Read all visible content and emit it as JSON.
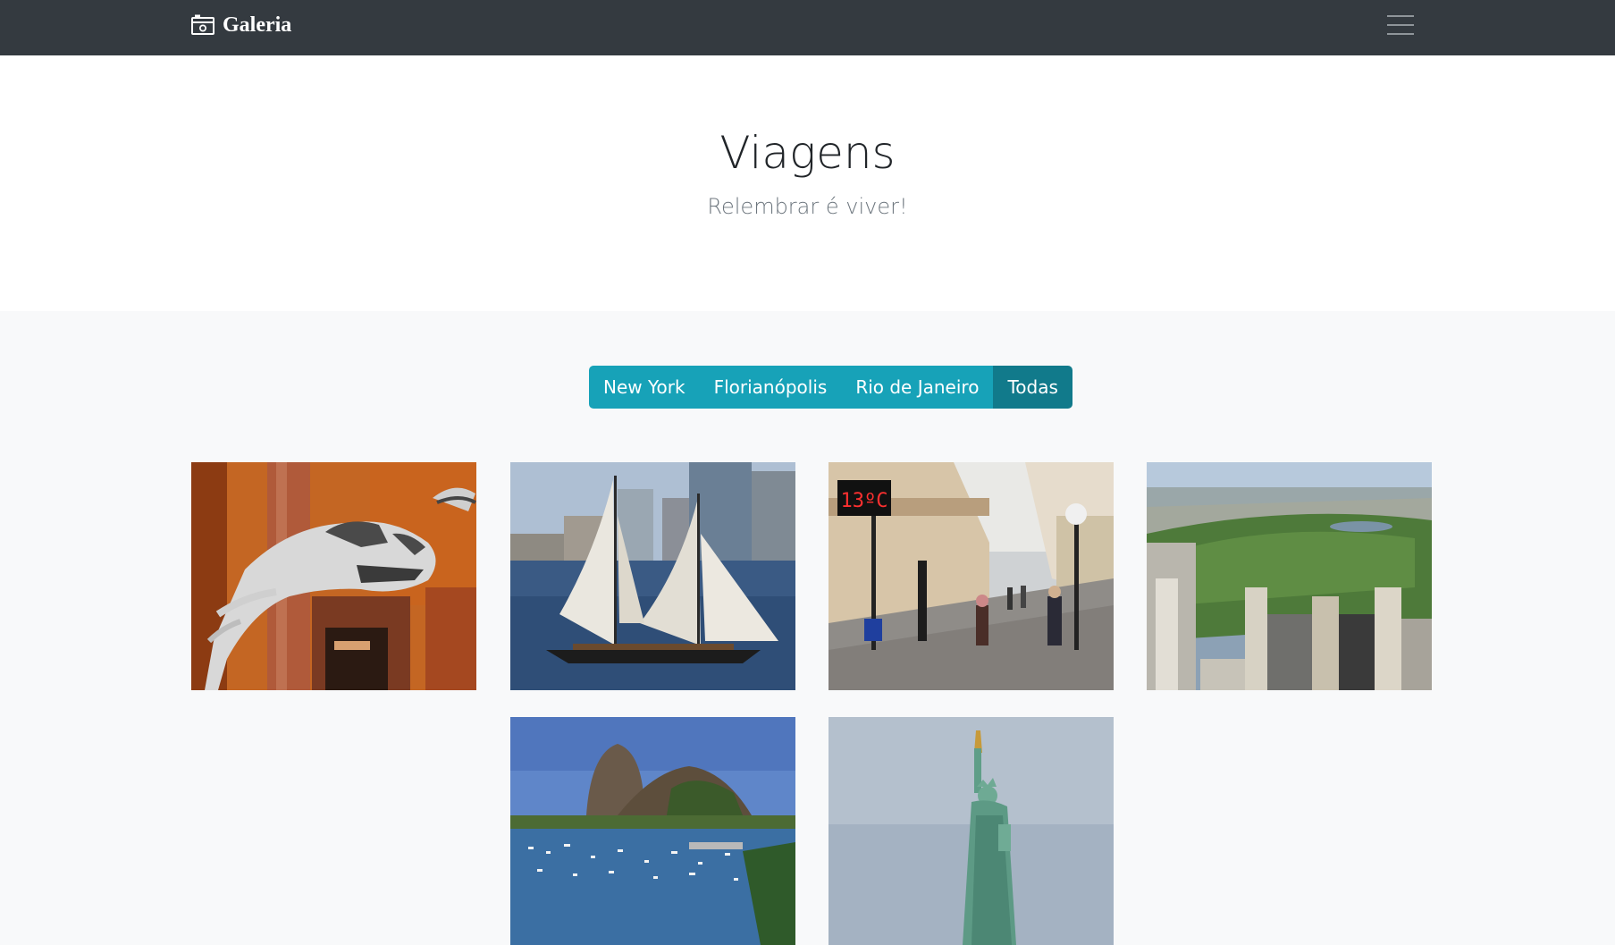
{
  "navbar": {
    "brand": "Galeria",
    "brand_icon": "camera-icon",
    "menu_icon": "hamburger-menu-icon"
  },
  "hero": {
    "title": "Viagens",
    "subtitle": "Relembrar é viver!"
  },
  "filters": [
    {
      "label": "New York",
      "active": false
    },
    {
      "label": "Florianópolis",
      "active": false
    },
    {
      "label": "Rio de Janeiro",
      "active": false
    },
    {
      "label": "Todas",
      "active": true
    }
  ],
  "photos": [
    {
      "subject": "dinosaur-skeleton",
      "tag": "New York"
    },
    {
      "subject": "sailboat",
      "tag": "New York"
    },
    {
      "subject": "street-thermometer",
      "thermometer_text": "13ºC",
      "tag": "Florianópolis"
    },
    {
      "subject": "central-park-aerial",
      "tag": "New York"
    },
    {
      "subject": "sugarloaf-mountain",
      "tag": "Rio de Janeiro"
    },
    {
      "subject": "statue-of-liberty",
      "tag": "New York"
    }
  ],
  "colors": {
    "navbar_bg": "#343a40",
    "filter_btn": "#17a2b8",
    "filter_btn_active": "#117a8b",
    "page_bg": "#f8f9fa"
  }
}
